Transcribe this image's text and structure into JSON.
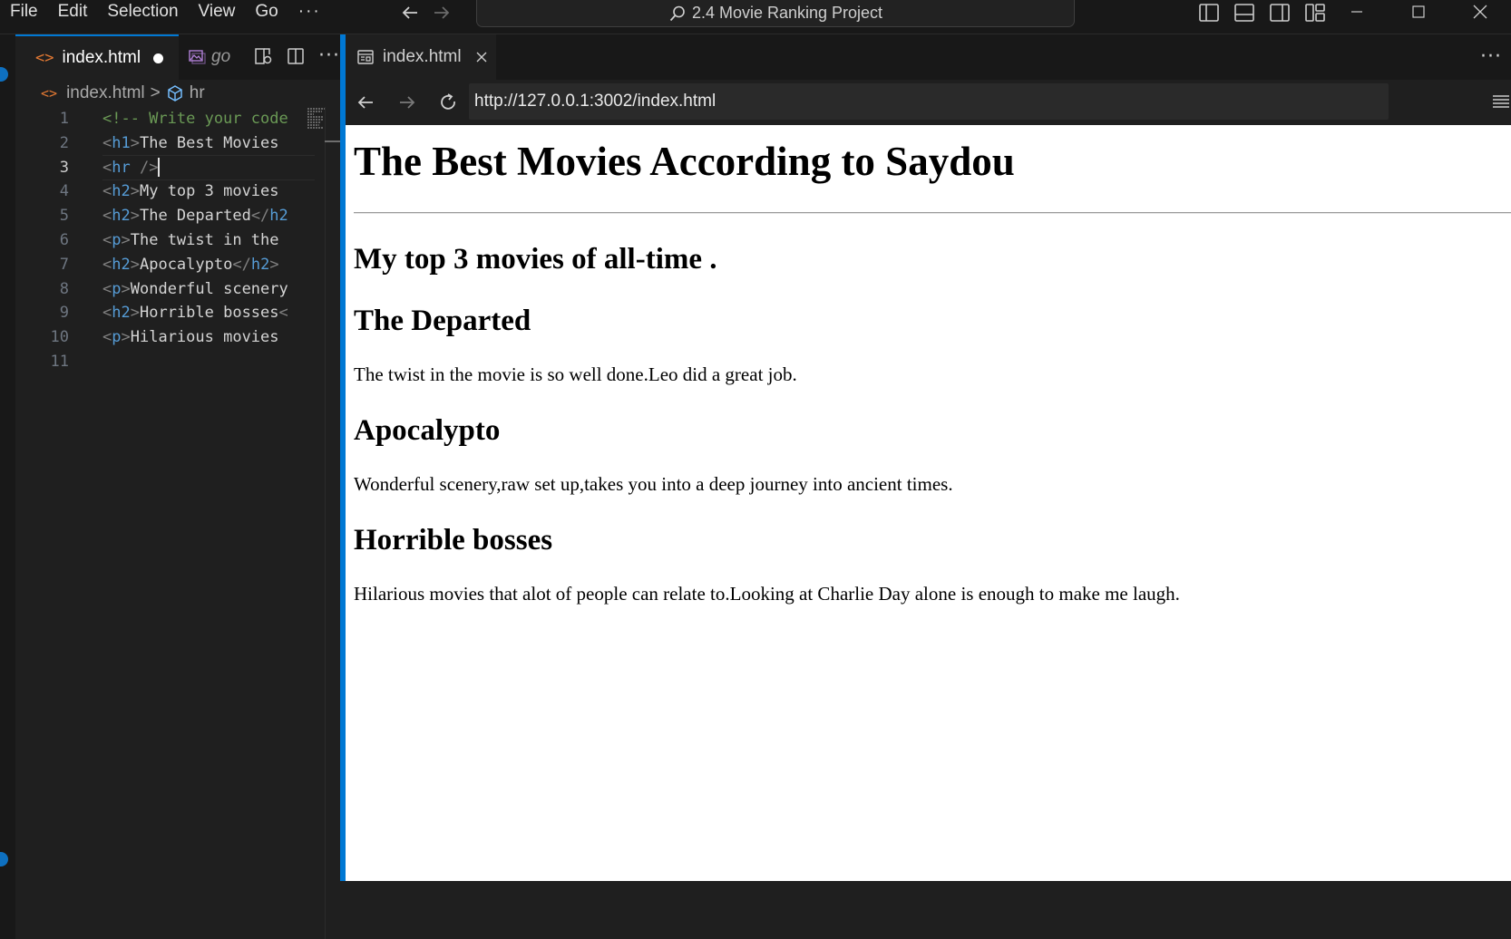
{
  "titlebar": {
    "menu": [
      "File",
      "Edit",
      "Selection",
      "View",
      "Go"
    ],
    "menu_more": "···",
    "title": "2.4 Movie Ranking Project"
  },
  "editor": {
    "active_tab": {
      "label": "index.html",
      "dirty": true
    },
    "preview_tab": {
      "label": "go"
    },
    "more": "···",
    "breadcrumb": {
      "file": "index.html",
      "symbol": "hr",
      "separator": ">"
    },
    "current_line": 3,
    "line_numbers": [
      "1",
      "2",
      "3",
      "4",
      "5",
      "6",
      "7",
      "8",
      "9",
      "10",
      "11"
    ],
    "code": {
      "l1_comment": "<!-- Write your code",
      "l2_open": "<",
      "l2_tag": "h1",
      "l2_close": ">",
      "l2_text": "The Best Movies",
      "l3_open": "<",
      "l3_tag": "hr",
      "l3_close": " />",
      "l4_open": "<",
      "l4_tag": "h2",
      "l4_close": ">",
      "l4_text": "My top 3 movies",
      "l5_open": "<",
      "l5_tag": "h2",
      "l5_close": ">",
      "l5_text": "The Departed",
      "l5_end_open": "</",
      "l5_end_tag": "h2",
      "l6_open": "<",
      "l6_tag": "p",
      "l6_close": ">",
      "l6_text": "The twist in the",
      "l7_open": "<",
      "l7_tag": "h2",
      "l7_close": ">",
      "l7_text": "Apocalypto",
      "l7_end_open": "</",
      "l7_end_tag": "h2",
      "l7_end_close": ">",
      "l8_open": "<",
      "l8_tag": "p",
      "l8_close": ">",
      "l8_text": "Wonderful scenery",
      "l9_open": "<",
      "l9_tag": "h2",
      "l9_close": ">",
      "l9_text": "Horrible bosses",
      "l9_end_open": "<",
      "l10_open": "<",
      "l10_tag": "p",
      "l10_close": ">",
      "l10_text": "Hilarious movies"
    }
  },
  "preview": {
    "tab_label": "index.html",
    "url": "http://127.0.0.1:3002/index.html",
    "more": "···",
    "page": {
      "h1": "The Best Movies According to Saydou",
      "subtitle": "My top 3 movies of all-time .",
      "movies": [
        {
          "title": "The Departed",
          "description": "The twist in the movie is so well done.Leo did a great job."
        },
        {
          "title": "Apocalypto",
          "description": "Wonderful scenery,raw set up,takes you into a deep journey into ancient times."
        },
        {
          "title": "Horrible bosses",
          "description": "Hilarious movies that alot of people can relate to.Looking at Charlie Day alone is enough to make me laugh."
        }
      ]
    }
  },
  "colors": {
    "accent": "#0078d4",
    "html_icon": "#e37933",
    "tag_name": "#569cd6",
    "comment": "#6a9955"
  },
  "icons": {
    "nav_back": "arrow-left-icon",
    "nav_forward": "arrow-right-icon",
    "search": "search-icon",
    "layout": [
      "toggle-primary-sidebar-icon",
      "toggle-panel-icon",
      "toggle-secondary-sidebar-icon",
      "customize-layout-icon"
    ],
    "window": [
      "minimize-icon",
      "maximize-icon",
      "close-icon"
    ],
    "preview_tab": "image-preview-icon",
    "open_changes": "open-changes-icon",
    "split": "split-editor-icon",
    "symbol": "cube-symbol-icon",
    "browser_tab": "browser-icon",
    "reload": "reload-icon",
    "menu": "hamburger-menu-icon"
  }
}
